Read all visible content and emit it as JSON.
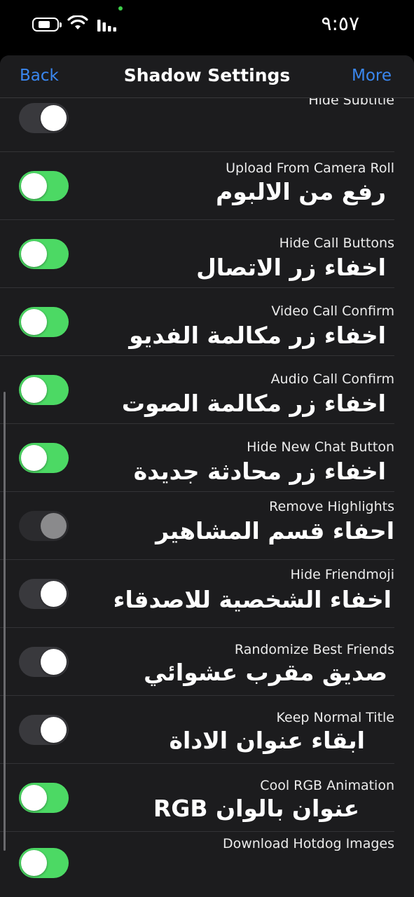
{
  "status_bar": {
    "time": "٩:٥٧",
    "icons": [
      "battery-icon",
      "wifi-icon",
      "signal-icon"
    ],
    "privacy_dot_color": "#3ecf4a"
  },
  "nav": {
    "back_label": "Back",
    "title": "Shadow Settings",
    "more_label": "More",
    "accent_color": "#3a87f0"
  },
  "colors": {
    "toggle_on": "#4cd964",
    "toggle_off": "#39393d",
    "background": "#1c1c1e"
  },
  "rows": [
    {
      "title": "Hide Subtitle",
      "subtitle_ar": "",
      "toggle": "on-off-white"
    },
    {
      "title": "Upload From Camera Roll",
      "subtitle_ar": "رفع من الالبوم",
      "toggle": "on"
    },
    {
      "title": "Hide Call Buttons",
      "subtitle_ar": "اخفاء زر الاتصال",
      "toggle": "on"
    },
    {
      "title": "Video Call Confirm",
      "subtitle_ar": "اخفاء زر مكالمة الفديو",
      "toggle": "on"
    },
    {
      "title": "Audio Call Confirm",
      "subtitle_ar": "اخفاء زر مكالمة الصوت",
      "toggle": "on"
    },
    {
      "title": "Hide New Chat Button",
      "subtitle_ar": "اخفاء زر محادثة جديدة",
      "toggle": "on"
    },
    {
      "title": "Remove Highlights",
      "subtitle_ar": "احفاء قسم المشاهير",
      "toggle": "off-disabled"
    },
    {
      "title": "Hide Friendmoji",
      "subtitle_ar": "اخفاء الشخصية للاصدقاء",
      "toggle": "off"
    },
    {
      "title": "Randomize Best Friends",
      "subtitle_ar": "صديق مقرب عشوائي",
      "toggle": "off"
    },
    {
      "title": "Keep Normal Title",
      "subtitle_ar": "ابقاء عنوان الاداة",
      "toggle": "off"
    },
    {
      "title": "Cool RGB Animation",
      "subtitle_ar": "عنوان بالوان RGB",
      "toggle": "on"
    },
    {
      "title": "Download Hotdog Images",
      "subtitle_ar": "",
      "toggle": "on"
    }
  ]
}
